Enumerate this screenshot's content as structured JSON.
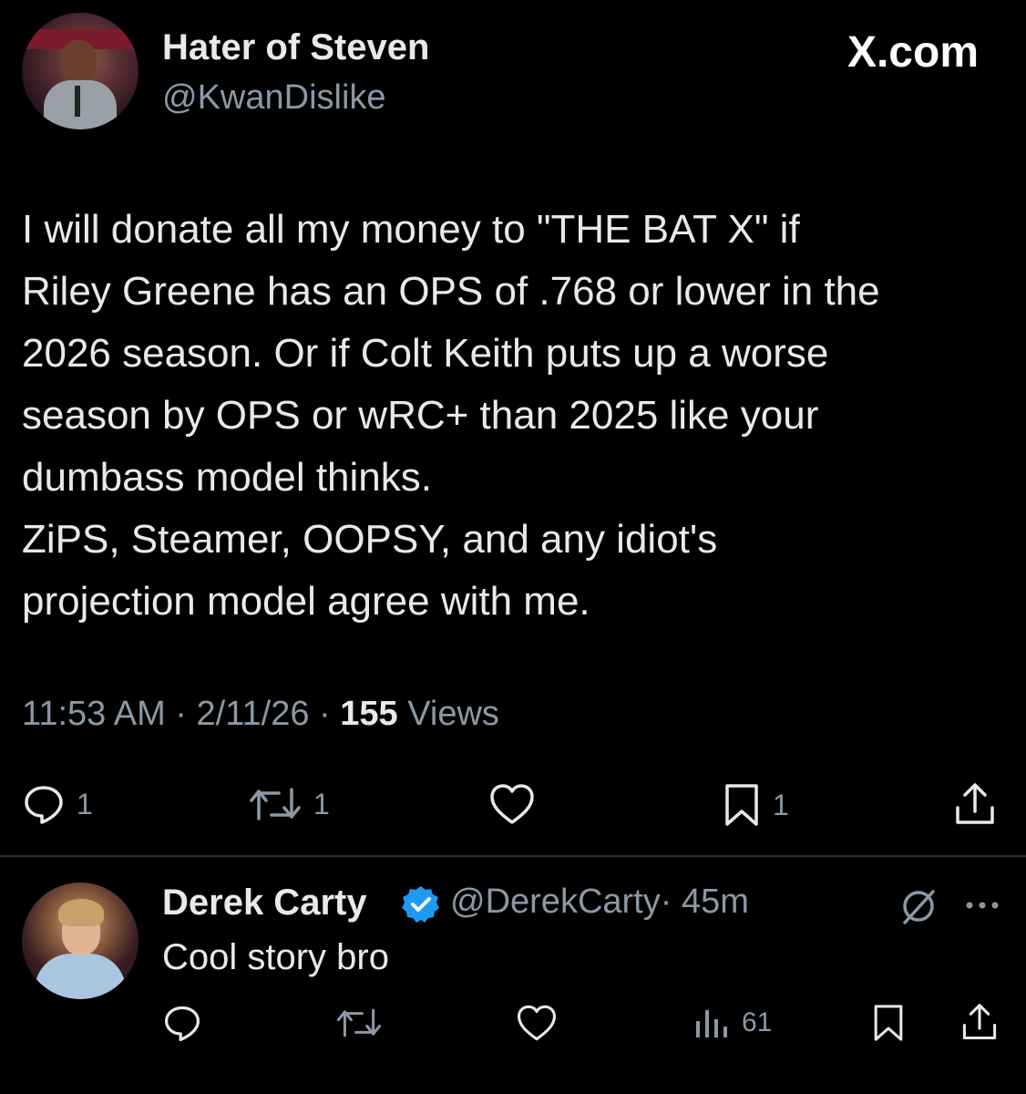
{
  "tweet": {
    "display_name": "Hater of Steven",
    "handle": "@KwanDislike",
    "site": "X.com",
    "text": "I will donate all my money to \"THE BAT X\" if\nRiley Greene has an OPS of .768 or lower in the\n2026 season. Or if Colt Keith puts up a worse\nseason by OPS or wRC+ than 2025 like your\ndumbass model thinks.\nZiPS, Steamer, OOPSY, and any idiot's\nprojection model agree with me.",
    "time": "11:53 AM",
    "date": "2/11/26",
    "separator": "·",
    "views_count": "155",
    "views_label": "Views",
    "actions": {
      "reply_count": "1",
      "repost_count": "1",
      "bookmark_count": "1"
    }
  },
  "reply": {
    "display_name": "Derek Carty",
    "handle": "@DerekCarty",
    "time": "· 45m",
    "text": "Cool story bro",
    "views_count": "61"
  },
  "colors": {
    "background": "#000000",
    "text": "#e7e9ea",
    "secondary": "#8b98a5",
    "verified": "#1d9bf0",
    "divider": "#2f3336"
  },
  "icons": [
    "reply-icon",
    "repost-icon",
    "like-icon",
    "bookmark-icon",
    "share-icon",
    "verified-badge-icon",
    "grok-icon",
    "more-icon",
    "views-icon"
  ]
}
